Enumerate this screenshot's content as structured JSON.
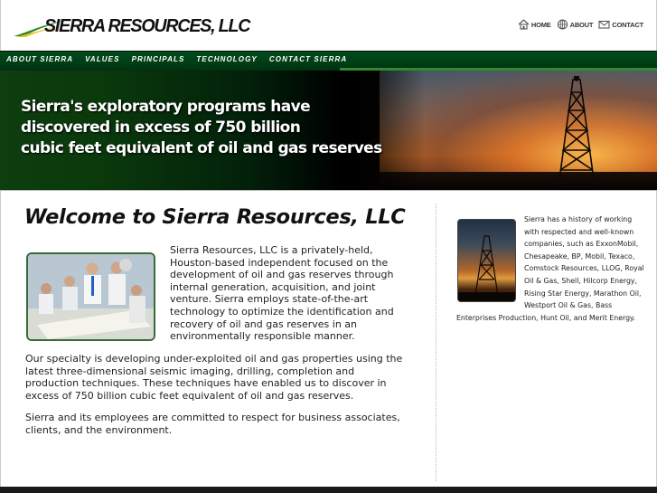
{
  "brand": {
    "name": "SIERRA RESOURCES, LLC",
    "swoosh_colors": [
      "#2e8b2e",
      "#f0c020"
    ]
  },
  "utility_nav": [
    {
      "label": "HOME",
      "icon": "home-icon"
    },
    {
      "label": "ABOUT",
      "icon": "info-globe-icon"
    },
    {
      "label": "CONTACT",
      "icon": "envelope-icon"
    }
  ],
  "main_nav": [
    "ABOUT SIERRA",
    "VALUES",
    "PRINCIPALS",
    "TECHNOLOGY",
    "CONTACT SIERRA"
  ],
  "banner": {
    "line1": "Sierra's exploratory programs have",
    "line2": "discovered in excess of 750 billion",
    "line3": "cubic feet equivalent of oil and gas reserves"
  },
  "content": {
    "heading": "Welcome to Sierra Resources, LLC",
    "paragraph1": "Sierra Resources, LLC is a privately-held, Houston-based independent focused on the development of oil and gas reserves through internal generation, acquisition, and joint venture. Sierra employs state-of-the-art technology to optimize the identification and recovery of oil and gas reserves in an environmentally responsible manner.",
    "paragraph2": "Our specialty is developing under-exploited oil and gas properties using the latest three-dimensional seismic imaging, drilling, completion and production techniques. These techniques have enabled us to discover in excess of 750 billion cubic feet equivalent of oil and gas reserves.",
    "paragraph3": "Sierra and its employees are committed to respect for business associates, clients, and the environment."
  },
  "sidebar": {
    "text": "Sierra has a history of working with respected and well-known companies, such as ExxonMobil, Chesapeake, BP, Mobil, Texaco, Comstock Resources, LLOG, Royal Oil & Gas, Shell, Hilcorp Energy, Rising Star Energy, Marathon Oil, Westport Oil & Gas, Bass Enterprises Production, Hunt Oil, and Merit Energy."
  },
  "colors": {
    "nav_green": "#004d1a",
    "accent_green": "#2e8b2e",
    "logo_yellow": "#f0c020"
  }
}
